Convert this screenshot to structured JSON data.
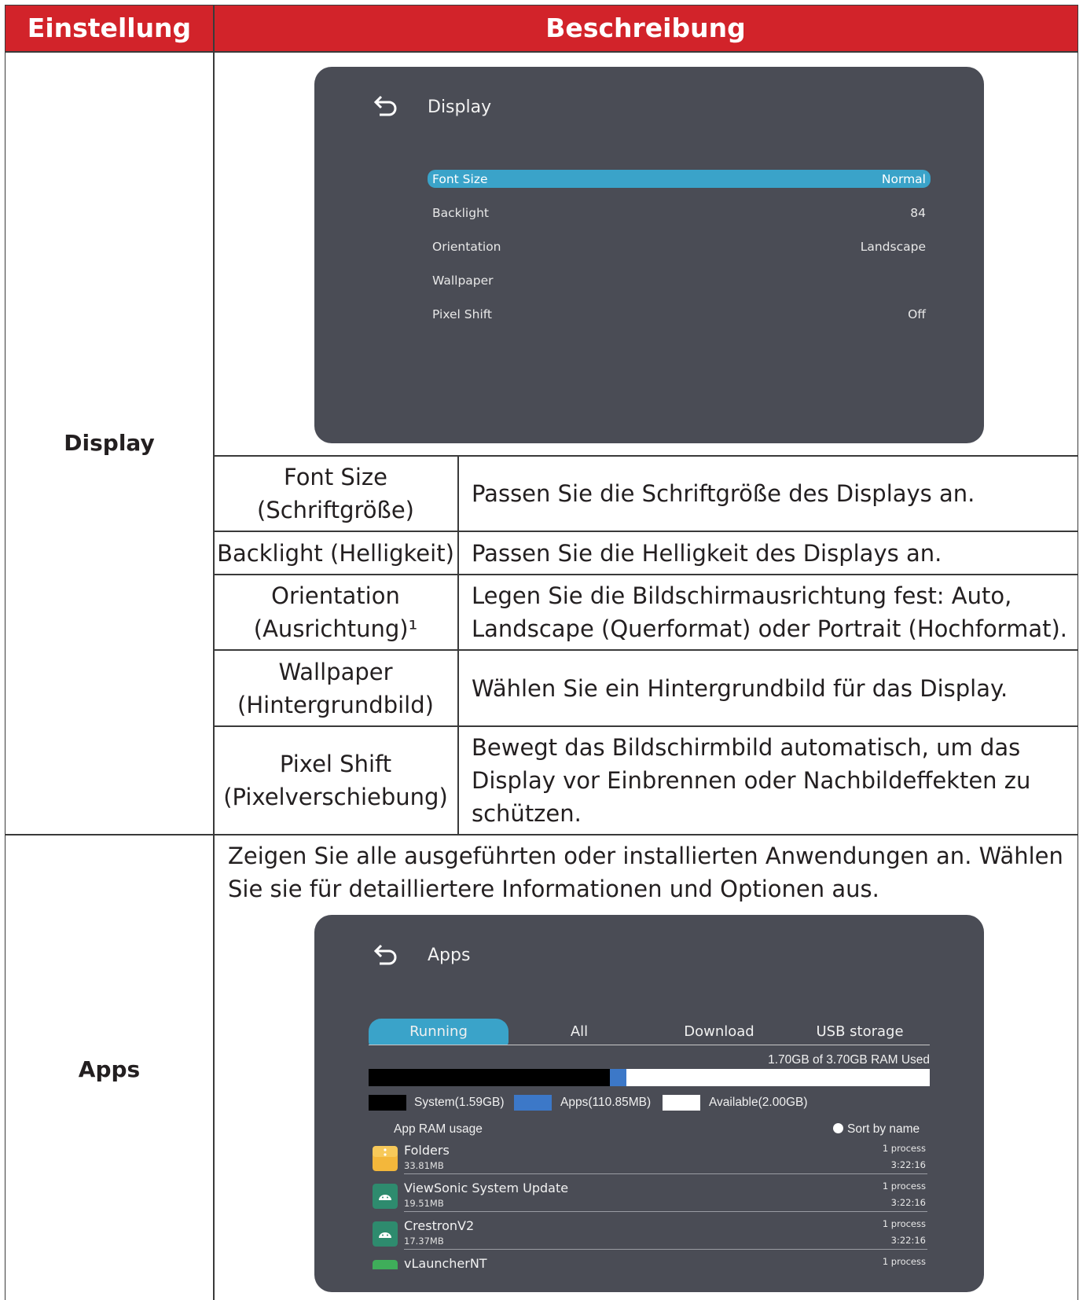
{
  "table": {
    "header": {
      "col1": "Einstellung",
      "col2": "Beschreibung"
    },
    "colors": {
      "header_bg": "#d2232a",
      "panel_bg": "#4a4c55",
      "highlight": "#3aa3c9"
    }
  },
  "display_section": {
    "name": "Display",
    "screen": {
      "back_icon": "back-arrow-icon",
      "title": "Display",
      "menu": [
        {
          "label": "Font Size",
          "value": "Normal",
          "selected": true
        },
        {
          "label": "Backlight",
          "value": "84",
          "selected": false
        },
        {
          "label": "Orientation",
          "value": "Landscape",
          "selected": false
        },
        {
          "label": "Wallpaper",
          "value": "",
          "selected": false
        },
        {
          "label": "Pixel Shift",
          "value": "Off",
          "selected": false
        }
      ]
    },
    "rows": [
      {
        "name": "Font Size (Schriftgröße)",
        "name_line1": "Font Size",
        "name_line2": "(Schriftgröße)",
        "desc": "Passen Sie die Schriftgröße des Displays an."
      },
      {
        "name": "Backlight (Helligkeit)",
        "desc": "Passen Sie die Helligkeit des Displays an."
      },
      {
        "name_line1": "Orientation",
        "name_line2": "(Ausrichtung)¹",
        "desc_line1": "Legen Sie die Bildschirmausrichtung fest: Auto,",
        "desc_line2": "Landscape (Querformat) oder Portrait (Hochformat)."
      },
      {
        "name_line1": "Wallpaper",
        "name_line2": "(Hintergrundbild)",
        "desc": "Wählen Sie ein Hintergrundbild für das Display."
      },
      {
        "name_line1": "Pixel Shift",
        "name_line2": "(Pixelverschiebung)",
        "desc_line1": "Bewegt das Bildschirmbild automatisch, um das",
        "desc_line2": "Display vor Einbrennen oder Nachbildeffekten zu",
        "desc_line3": "schützen."
      }
    ]
  },
  "apps_section": {
    "name": "Apps",
    "intro_line1": "Zeigen Sie alle ausgeführten oder installierten Anwendungen an. Wählen",
    "intro_line2": "Sie sie für detailliertere Informationen und Optionen aus.",
    "screen": {
      "back_icon": "back-arrow-icon",
      "title": "Apps",
      "tabs": [
        "Running",
        "All",
        "Download",
        "USB storage"
      ],
      "active_tab": "Running",
      "ram_used": "1.70GB of 3.70GB RAM Used",
      "ram_fraction": {
        "system": 0.43,
        "apps": 0.03,
        "available": 0.54
      },
      "legend": {
        "system": "System(1.59GB)",
        "apps": "Apps(110.85MB)",
        "available": "Available(2.00GB)"
      },
      "usage_label": "App RAM usage",
      "sort_label": "Sort by name",
      "apps": [
        {
          "name": "Folders",
          "size": "33.81MB",
          "process": "1 process",
          "time": "3:22:16",
          "icon": "folder-icon"
        },
        {
          "name": "ViewSonic System Update",
          "size": "19.51MB",
          "process": "1 process",
          "time": "3:22:16",
          "icon": "android-icon"
        },
        {
          "name": "CrestronV2",
          "size": "17.37MB",
          "process": "1 process",
          "time": "3:22:16",
          "icon": "android-icon"
        },
        {
          "name": "vLauncherNT",
          "process": "1 process",
          "icon": "android-icon"
        }
      ]
    }
  }
}
